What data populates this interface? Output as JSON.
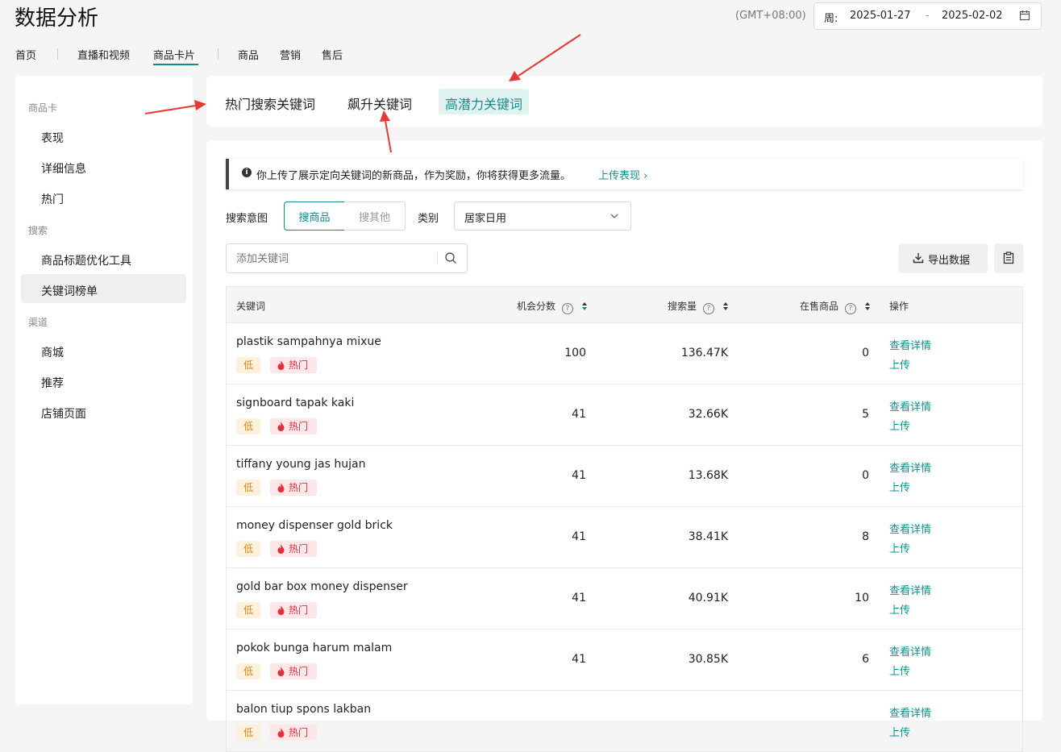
{
  "header": {
    "title": "数据分析",
    "timezone": "(GMT+08:00)",
    "date_prefix": "周:",
    "date_start": "2025-01-27",
    "date_sep": "-",
    "date_end": "2025-02-02"
  },
  "nav": {
    "home": "首页",
    "live_video": "直播和视频",
    "product_card": "商品卡片",
    "product": "商品",
    "marketing": "营销",
    "after_sales": "售后"
  },
  "sidebar": {
    "group1": "商品卡",
    "item_performance": "表现",
    "item_details": "详细信息",
    "item_hot": "热门",
    "group2": "搜索",
    "item_title_tool": "商品标题优化工具",
    "item_keyword_rank": "关键词榜单",
    "group3": "渠道",
    "item_mall": "商城",
    "item_recommend": "推荐",
    "item_shop_page": "店铺页面"
  },
  "tabs": {
    "hot": "热门搜索关键词",
    "rising": "飙升关键词",
    "potential": "高潜力关键词"
  },
  "notice": {
    "text": "你上传了展示定向关键词的新商品，作为奖励，你将获得更多流量。",
    "link": "上传表现 ›"
  },
  "filters": {
    "intent_label": "搜索意图",
    "search_product": "搜商品",
    "search_other": "搜其他",
    "category_label": "类别",
    "category_value": "居家日用",
    "keyword_placeholder": "添加关键词",
    "export_label": "导出数据"
  },
  "table": {
    "col_keyword": "关键词",
    "col_score": "机会分数",
    "col_volume": "搜索量",
    "col_products": "在售商品",
    "col_action": "操作",
    "tag_low": "低",
    "tag_hot": "热门",
    "action_view": "查看详情",
    "action_upload": "上传",
    "rows": [
      {
        "keyword": "plastik sampahnya mixue",
        "score": "100",
        "volume": "136.47K",
        "products": "0"
      },
      {
        "keyword": "signboard tapak kaki",
        "score": "41",
        "volume": "32.66K",
        "products": "5"
      },
      {
        "keyword": "tiffany young jas hujan",
        "score": "41",
        "volume": "13.68K",
        "products": "0"
      },
      {
        "keyword": "money dispenser gold brick",
        "score": "41",
        "volume": "38.41K",
        "products": "8"
      },
      {
        "keyword": "gold bar box money dispenser",
        "score": "41",
        "volume": "40.91K",
        "products": "10"
      },
      {
        "keyword": "pokok bunga harum malam",
        "score": "41",
        "volume": "30.85K",
        "products": "6"
      },
      {
        "keyword": "balon tiup spons lakban",
        "score": "",
        "volume": "",
        "products": ""
      }
    ]
  },
  "colors": {
    "accent": "#138a8a",
    "annotation_arrow": "#e53935"
  }
}
